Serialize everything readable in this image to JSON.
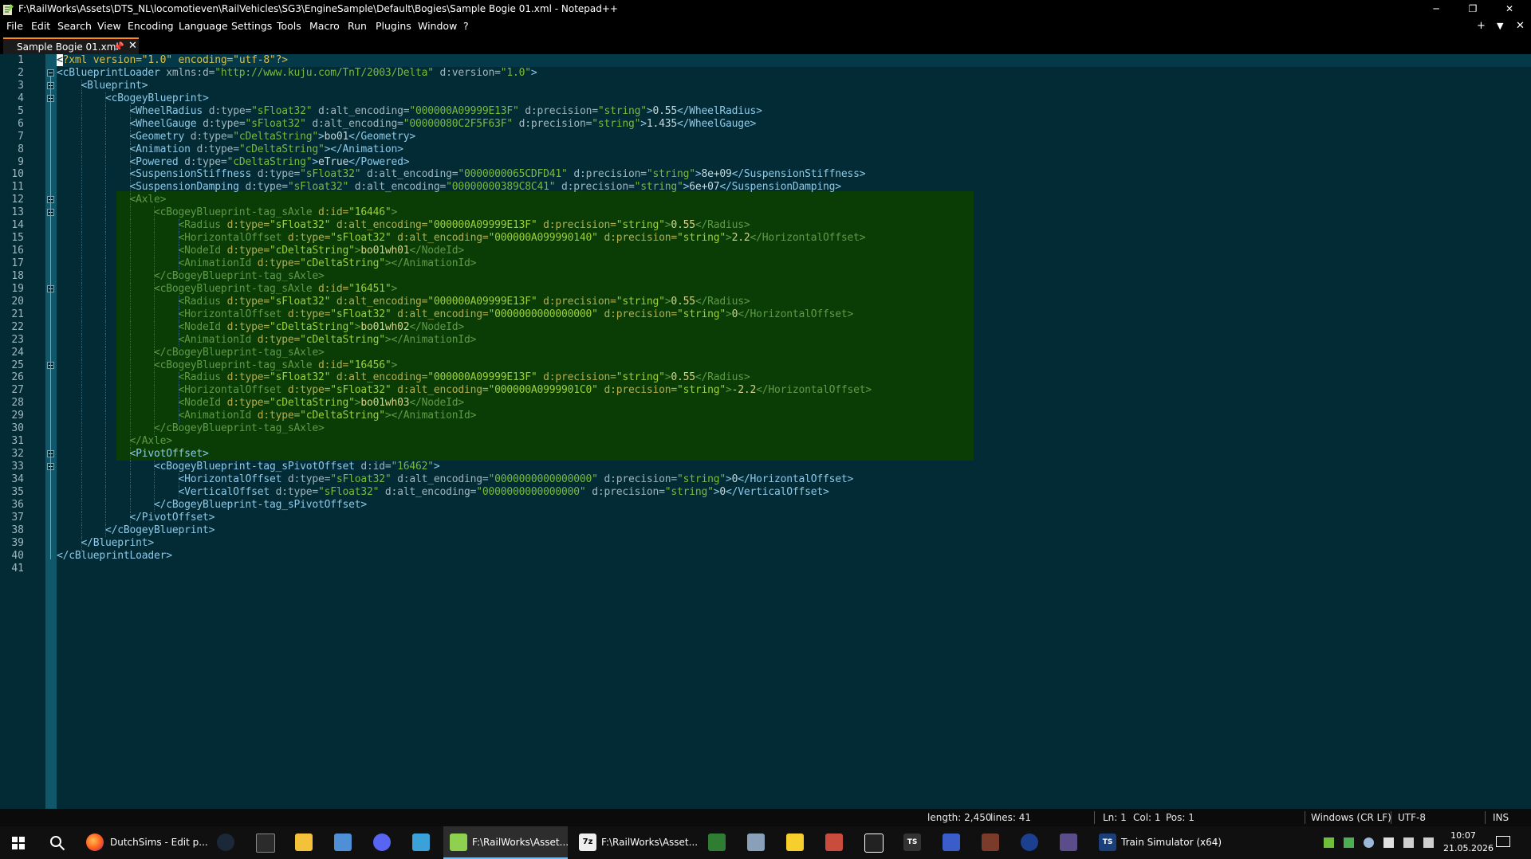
{
  "window": {
    "title": "F:\\RailWorks\\Assets\\DTS_NL\\locomotieven\\RailVehicles\\SG3\\EngineSample\\Default\\Bogies\\Sample Bogie 01.xml - Notepad++",
    "minimize": "─",
    "restore": "❐",
    "close": "✕"
  },
  "menu": {
    "items": [
      "File",
      "Edit",
      "Search",
      "View",
      "Encoding",
      "Language",
      "Settings",
      "Tools",
      "Macro",
      "Run",
      "Plugins",
      "Window",
      "?"
    ],
    "right": [
      "+",
      "▼",
      "✕"
    ]
  },
  "tab": {
    "label": "Sample Bogie 01.xml",
    "pin": "📌",
    "close": "✕"
  },
  "editor": {
    "line_numbers": [
      "1",
      "2",
      "3",
      "4",
      "5",
      "6",
      "7",
      "8",
      "9",
      "10",
      "11",
      "12",
      "13",
      "14",
      "15",
      "16",
      "17",
      "18",
      "19",
      "20",
      "21",
      "22",
      "23",
      "24",
      "25",
      "26",
      "27",
      "28",
      "29",
      "30",
      "31",
      "32",
      "33",
      "34",
      "35",
      "36",
      "37",
      "38",
      "39",
      "40",
      "41"
    ],
    "selection_lines": [
      12,
      31
    ],
    "fold_marker_lines": [
      2,
      3,
      4,
      12,
      13,
      19,
      25,
      32,
      33
    ],
    "lines": [
      {
        "indent": 0,
        "parts": [
          [
            "caret",
            "<"
          ],
          [
            "pi",
            "?xml version=\"1.0\" encoding=\"utf-8\"?>"
          ]
        ]
      },
      {
        "indent": 0,
        "parts": [
          [
            "tag",
            "<cBlueprintLoader"
          ],
          [
            "attr",
            " xmlns:d="
          ],
          [
            "val",
            "\"http://www.kuju.com/TnT/2003/Delta\""
          ],
          [
            "attr",
            " d:version="
          ],
          [
            "val",
            "\"1.0\""
          ],
          [
            "tag",
            ">"
          ]
        ]
      },
      {
        "indent": 1,
        "parts": [
          [
            "tag",
            "<Blueprint>"
          ]
        ]
      },
      {
        "indent": 2,
        "parts": [
          [
            "tag",
            "<cBogeyBlueprint>"
          ]
        ]
      },
      {
        "indent": 3,
        "parts": [
          [
            "tag",
            "<WheelRadius"
          ],
          [
            "attr",
            " d:type="
          ],
          [
            "val",
            "\"sFloat32\""
          ],
          [
            "attr",
            " d:alt_encoding="
          ],
          [
            "val",
            "\"000000A09999E13F\""
          ],
          [
            "attr",
            " d:precision="
          ],
          [
            "val",
            "\"string\""
          ],
          [
            "tag",
            ">"
          ],
          [
            "text",
            "0.55"
          ],
          [
            "tag",
            "</WheelRadius>"
          ]
        ]
      },
      {
        "indent": 3,
        "parts": [
          [
            "tag",
            "<WheelGauge"
          ],
          [
            "attr",
            " d:type="
          ],
          [
            "val",
            "\"sFloat32\""
          ],
          [
            "attr",
            " d:alt_encoding="
          ],
          [
            "val",
            "\"00000080C2F5F63F\""
          ],
          [
            "attr",
            " d:precision="
          ],
          [
            "val",
            "\"string\""
          ],
          [
            "tag",
            ">"
          ],
          [
            "text",
            "1.435"
          ],
          [
            "tag",
            "</WheelGauge>"
          ]
        ]
      },
      {
        "indent": 3,
        "parts": [
          [
            "tag",
            "<Geometry"
          ],
          [
            "attr",
            " d:type="
          ],
          [
            "val",
            "\"cDeltaString\""
          ],
          [
            "tag",
            ">"
          ],
          [
            "text",
            "bo01"
          ],
          [
            "tag",
            "</Geometry>"
          ]
        ]
      },
      {
        "indent": 3,
        "parts": [
          [
            "tag",
            "<Animation"
          ],
          [
            "attr",
            " d:type="
          ],
          [
            "val",
            "\"cDeltaString\""
          ],
          [
            "tag",
            "></Animation>"
          ]
        ]
      },
      {
        "indent": 3,
        "parts": [
          [
            "tag",
            "<Powered"
          ],
          [
            "attr",
            " d:type="
          ],
          [
            "val",
            "\"cDeltaString\""
          ],
          [
            "tag",
            ">"
          ],
          [
            "text",
            "eTrue"
          ],
          [
            "tag",
            "</Powered>"
          ]
        ]
      },
      {
        "indent": 3,
        "parts": [
          [
            "tag",
            "<SuspensionStiffness"
          ],
          [
            "attr",
            " d:type="
          ],
          [
            "val",
            "\"sFloat32\""
          ],
          [
            "attr",
            " d:alt_encoding="
          ],
          [
            "val",
            "\"0000000065CDFD41\""
          ],
          [
            "attr",
            " d:precision="
          ],
          [
            "val",
            "\"string\""
          ],
          [
            "tag",
            ">"
          ],
          [
            "text",
            "8e+09"
          ],
          [
            "tag",
            "</SuspensionStiffness>"
          ]
        ]
      },
      {
        "indent": 3,
        "parts": [
          [
            "tag",
            "<SuspensionDamping"
          ],
          [
            "attr",
            " d:type="
          ],
          [
            "val",
            "\"sFloat32\""
          ],
          [
            "attr",
            " d:alt_encoding="
          ],
          [
            "val",
            "\"00000000389C8C41\""
          ],
          [
            "attr",
            " d:precision="
          ],
          [
            "val",
            "\"string\""
          ],
          [
            "tag",
            ">"
          ],
          [
            "text",
            "6e+07"
          ],
          [
            "tag",
            "</SuspensionDamping>"
          ]
        ]
      },
      {
        "indent": 3,
        "parts": [
          [
            "tag",
            "<Axle>"
          ]
        ]
      },
      {
        "indent": 4,
        "parts": [
          [
            "tag",
            "<cBogeyBlueprint-tag_sAxle"
          ],
          [
            "attr",
            " d:id="
          ],
          [
            "val",
            "\"16446\""
          ],
          [
            "tag",
            ">"
          ]
        ]
      },
      {
        "indent": 5,
        "parts": [
          [
            "tag",
            "<Radius"
          ],
          [
            "attr",
            " d:type="
          ],
          [
            "val",
            "\"sFloat32\""
          ],
          [
            "attr",
            " d:alt_encoding="
          ],
          [
            "val",
            "\"000000A09999E13F\""
          ],
          [
            "attr",
            " d:precision="
          ],
          [
            "val",
            "\"string\""
          ],
          [
            "tag",
            ">"
          ],
          [
            "text",
            "0.55"
          ],
          [
            "tag",
            "</Radius>"
          ]
        ]
      },
      {
        "indent": 5,
        "parts": [
          [
            "tag",
            "<HorizontalOffset"
          ],
          [
            "attr",
            " d:type="
          ],
          [
            "val",
            "\"sFloat32\""
          ],
          [
            "attr",
            " d:alt_encoding="
          ],
          [
            "val",
            "\"000000A099990140\""
          ],
          [
            "attr",
            " d:precision="
          ],
          [
            "val",
            "\"string\""
          ],
          [
            "tag",
            ">"
          ],
          [
            "text",
            "2.2"
          ],
          [
            "tag",
            "</HorizontalOffset>"
          ]
        ]
      },
      {
        "indent": 5,
        "parts": [
          [
            "tag",
            "<NodeId"
          ],
          [
            "attr",
            " d:type="
          ],
          [
            "val",
            "\"cDeltaString\""
          ],
          [
            "tag",
            ">"
          ],
          [
            "text",
            "bo01wh01"
          ],
          [
            "tag",
            "</NodeId>"
          ]
        ]
      },
      {
        "indent": 5,
        "parts": [
          [
            "tag",
            "<AnimationId"
          ],
          [
            "attr",
            " d:type="
          ],
          [
            "val",
            "\"cDeltaString\""
          ],
          [
            "tag",
            "></AnimationId>"
          ]
        ]
      },
      {
        "indent": 4,
        "parts": [
          [
            "tag",
            "</cBogeyBlueprint-tag_sAxle>"
          ]
        ]
      },
      {
        "indent": 4,
        "parts": [
          [
            "tag",
            "<cBogeyBlueprint-tag_sAxle"
          ],
          [
            "attr",
            " d:id="
          ],
          [
            "val",
            "\"16451\""
          ],
          [
            "tag",
            ">"
          ]
        ]
      },
      {
        "indent": 5,
        "parts": [
          [
            "tag",
            "<Radius"
          ],
          [
            "attr",
            " d:type="
          ],
          [
            "val",
            "\"sFloat32\""
          ],
          [
            "attr",
            " d:alt_encoding="
          ],
          [
            "val",
            "\"000000A09999E13F\""
          ],
          [
            "attr",
            " d:precision="
          ],
          [
            "val",
            "\"string\""
          ],
          [
            "tag",
            ">"
          ],
          [
            "text",
            "0.55"
          ],
          [
            "tag",
            "</Radius>"
          ]
        ]
      },
      {
        "indent": 5,
        "parts": [
          [
            "tag",
            "<HorizontalOffset"
          ],
          [
            "attr",
            " d:type="
          ],
          [
            "val",
            "\"sFloat32\""
          ],
          [
            "attr",
            " d:alt_encoding="
          ],
          [
            "val",
            "\"0000000000000000\""
          ],
          [
            "attr",
            " d:precision="
          ],
          [
            "val",
            "\"string\""
          ],
          [
            "tag",
            ">"
          ],
          [
            "text",
            "0"
          ],
          [
            "tag",
            "</HorizontalOffset>"
          ]
        ]
      },
      {
        "indent": 5,
        "parts": [
          [
            "tag",
            "<NodeId"
          ],
          [
            "attr",
            " d:type="
          ],
          [
            "val",
            "\"cDeltaString\""
          ],
          [
            "tag",
            ">"
          ],
          [
            "text",
            "bo01wh02"
          ],
          [
            "tag",
            "</NodeId>"
          ]
        ]
      },
      {
        "indent": 5,
        "parts": [
          [
            "tag",
            "<AnimationId"
          ],
          [
            "attr",
            " d:type="
          ],
          [
            "val",
            "\"cDeltaString\""
          ],
          [
            "tag",
            "></AnimationId>"
          ]
        ]
      },
      {
        "indent": 4,
        "parts": [
          [
            "tag",
            "</cBogeyBlueprint-tag_sAxle>"
          ]
        ]
      },
      {
        "indent": 4,
        "parts": [
          [
            "tag",
            "<cBogeyBlueprint-tag_sAxle"
          ],
          [
            "attr",
            " d:id="
          ],
          [
            "val",
            "\"16456\""
          ],
          [
            "tag",
            ">"
          ]
        ]
      },
      {
        "indent": 5,
        "parts": [
          [
            "tag",
            "<Radius"
          ],
          [
            "attr",
            " d:type="
          ],
          [
            "val",
            "\"sFloat32\""
          ],
          [
            "attr",
            " d:alt_encoding="
          ],
          [
            "val",
            "\"000000A09999E13F\""
          ],
          [
            "attr",
            " d:precision="
          ],
          [
            "val",
            "\"string\""
          ],
          [
            "tag",
            ">"
          ],
          [
            "text",
            "0.55"
          ],
          [
            "tag",
            "</Radius>"
          ]
        ]
      },
      {
        "indent": 5,
        "parts": [
          [
            "tag",
            "<HorizontalOffset"
          ],
          [
            "attr",
            " d:type="
          ],
          [
            "val",
            "\"sFloat32\""
          ],
          [
            "attr",
            " d:alt_encoding="
          ],
          [
            "val",
            "\"000000A0999901C0\""
          ],
          [
            "attr",
            " d:precision="
          ],
          [
            "val",
            "\"string\""
          ],
          [
            "tag",
            ">"
          ],
          [
            "text",
            "-2.2"
          ],
          [
            "tag",
            "</HorizontalOffset>"
          ]
        ]
      },
      {
        "indent": 5,
        "parts": [
          [
            "tag",
            "<NodeId"
          ],
          [
            "attr",
            " d:type="
          ],
          [
            "val",
            "\"cDeltaString\""
          ],
          [
            "tag",
            ">"
          ],
          [
            "text",
            "bo01wh03"
          ],
          [
            "tag",
            "</NodeId>"
          ]
        ]
      },
      {
        "indent": 5,
        "parts": [
          [
            "tag",
            "<AnimationId"
          ],
          [
            "attr",
            " d:type="
          ],
          [
            "val",
            "\"cDeltaString\""
          ],
          [
            "tag",
            "></AnimationId>"
          ]
        ]
      },
      {
        "indent": 4,
        "parts": [
          [
            "tag",
            "</cBogeyBlueprint-tag_sAxle>"
          ]
        ]
      },
      {
        "indent": 3,
        "parts": [
          [
            "tag",
            "</Axle>"
          ]
        ]
      },
      {
        "indent": 3,
        "parts": [
          [
            "tag",
            "<PivotOffset>"
          ]
        ]
      },
      {
        "indent": 4,
        "parts": [
          [
            "tag",
            "<cBogeyBlueprint-tag_sPivotOffset"
          ],
          [
            "attr",
            " d:id="
          ],
          [
            "val",
            "\"16462\""
          ],
          [
            "tag",
            ">"
          ]
        ]
      },
      {
        "indent": 5,
        "parts": [
          [
            "tag",
            "<HorizontalOffset"
          ],
          [
            "attr",
            " d:type="
          ],
          [
            "val",
            "\"sFloat32\""
          ],
          [
            "attr",
            " d:alt_encoding="
          ],
          [
            "val",
            "\"0000000000000000\""
          ],
          [
            "attr",
            " d:precision="
          ],
          [
            "val",
            "\"string\""
          ],
          [
            "tag",
            ">"
          ],
          [
            "text",
            "0"
          ],
          [
            "tag",
            "</HorizontalOffset>"
          ]
        ]
      },
      {
        "indent": 5,
        "parts": [
          [
            "tag",
            "<VerticalOffset"
          ],
          [
            "attr",
            " d:type="
          ],
          [
            "val",
            "\"sFloat32\""
          ],
          [
            "attr",
            " d:alt_encoding="
          ],
          [
            "val",
            "\"0000000000000000\""
          ],
          [
            "attr",
            " d:precision="
          ],
          [
            "val",
            "\"string\""
          ],
          [
            "tag",
            ">"
          ],
          [
            "text",
            "0"
          ],
          [
            "tag",
            "</VerticalOffset>"
          ]
        ]
      },
      {
        "indent": 4,
        "parts": [
          [
            "tag",
            "</cBogeyBlueprint-tag_sPivotOffset>"
          ]
        ]
      },
      {
        "indent": 3,
        "parts": [
          [
            "tag",
            "</PivotOffset>"
          ]
        ]
      },
      {
        "indent": 2,
        "parts": [
          [
            "tag",
            "</cBogeyBlueprint>"
          ]
        ]
      },
      {
        "indent": 1,
        "parts": [
          [
            "tag",
            "</Blueprint>"
          ]
        ]
      },
      {
        "indent": 0,
        "parts": [
          [
            "tag",
            "</cBlueprintLoader>"
          ]
        ]
      },
      {
        "indent": 0,
        "parts": []
      }
    ]
  },
  "status": {
    "length": "length: 2,450",
    "lines": "lines: 41",
    "ln": "Ln: 1",
    "col": "Col: 1",
    "pos": "Pos: 1",
    "eol": "Windows (CR LF)",
    "encoding": "UTF-8",
    "mode": "INS"
  },
  "taskbar": {
    "firefox_label": "DutchSims - Edit p...",
    "npp_label": "F:\\RailWorks\\Asset...",
    "sevenzip_label": "F:\\RailWorks\\Asset...",
    "ts_label": "Train Simulator (x64)",
    "time": "10:07",
    "date": "21.05.2026"
  },
  "colors": {
    "editor_bg": "#022b35",
    "selection_bg": "#0a3d05",
    "tab_accent": "#ff8a1c",
    "taskbar_bg": "#101010"
  }
}
